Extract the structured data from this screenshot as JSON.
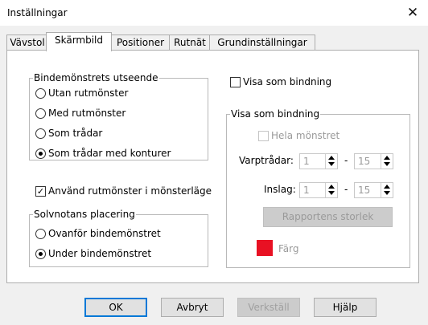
{
  "window": {
    "title": "Inställningar",
    "close_glyph": "✕"
  },
  "tabs": [
    {
      "label": "Vävstol",
      "active": false
    },
    {
      "label": "Skärmbild",
      "active": true
    },
    {
      "label": "Positioner",
      "active": false
    },
    {
      "label": "Rutnät",
      "active": false
    },
    {
      "label": "Grundinställningar",
      "active": false
    }
  ],
  "appearance_group": {
    "legend": "Bindemönstrets utseende",
    "options": [
      "Utan rutmönster",
      "Med rutmönster",
      "Som trådar",
      "Som trådar med konturer"
    ],
    "selected": "Som trådar med konturer"
  },
  "grid_checkbox": {
    "label": "Använd rutmönster i mönsterläge",
    "checked": true
  },
  "solvnotan_group": {
    "legend": "Solvnotans placering",
    "options": [
      "Ovanför bindemönstret",
      "Under bindemönstret"
    ],
    "selected": "Under bindemönstret"
  },
  "show_binding_checkbox": {
    "label": "Visa som bindning",
    "checked": false
  },
  "binding_group": {
    "legend": "Visa som bindning",
    "whole_pattern": {
      "label": "Hela mönstret",
      "checked": false,
      "enabled": false
    },
    "warp_label": "Varptrådar:",
    "weft_label": "Inslag:",
    "warp_from": "1",
    "warp_to": "15",
    "weft_from": "1",
    "weft_to": "15",
    "dash": "-",
    "report_size_button": "Rapportens storlek",
    "color_label": "Färg",
    "color_value": "#e81123"
  },
  "buttons": {
    "ok": "OK",
    "cancel": "Avbryt",
    "apply": "Verkställ",
    "help": "Hjälp"
  }
}
